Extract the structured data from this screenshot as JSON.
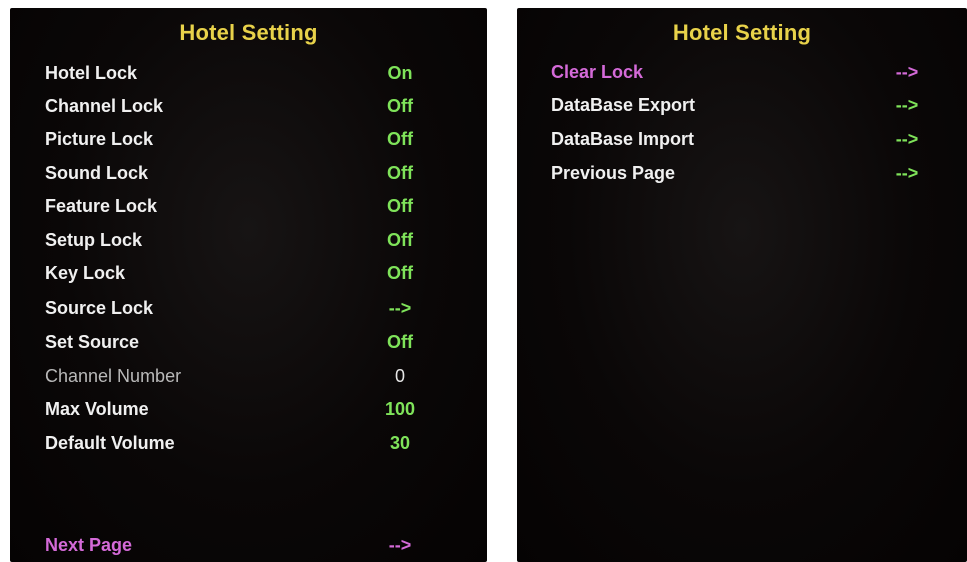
{
  "left_screen": {
    "title": "Hotel Setting",
    "items": [
      {
        "label": "Hotel Lock",
        "value": "On"
      },
      {
        "label": "Channel Lock",
        "value": "Off"
      },
      {
        "label": "Picture Lock",
        "value": "Off"
      },
      {
        "label": "Sound Lock",
        "value": "Off"
      },
      {
        "label": "Feature Lock",
        "value": "Off"
      },
      {
        "label": "Setup Lock",
        "value": "Off"
      },
      {
        "label": "Key Lock",
        "value": "Off"
      },
      {
        "label": "Source Lock",
        "value": "-->"
      },
      {
        "label": "Set Source",
        "value": "Off"
      },
      {
        "label": "Channel Number",
        "value": "0"
      },
      {
        "label": "Max Volume",
        "value": "100"
      },
      {
        "label": "Default Volume",
        "value": "30"
      }
    ],
    "next_page": {
      "label": "Next Page",
      "value": "-->"
    }
  },
  "right_screen": {
    "title": "Hotel Setting",
    "items": [
      {
        "label": "Clear Lock",
        "value": "-->"
      },
      {
        "label": "DataBase Export",
        "value": "-->"
      },
      {
        "label": "DataBase Import",
        "value": "-->"
      },
      {
        "label": "Previous Page",
        "value": "-->"
      }
    ]
  },
  "colors": {
    "title": "#e8d24a",
    "label": "#f0f0f0",
    "value": "#7fe35a",
    "highlight": "#d46ad8",
    "background": "#0a0707"
  }
}
